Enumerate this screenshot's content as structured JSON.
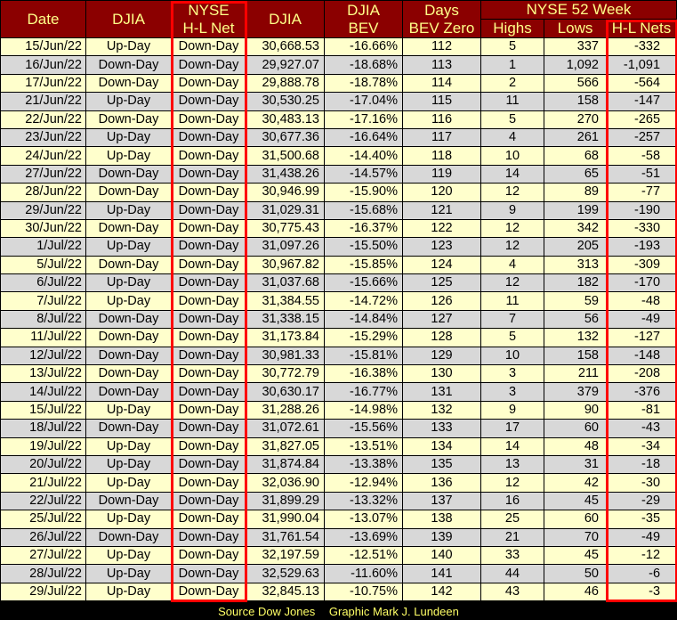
{
  "chart_data": {
    "type": "table",
    "header_groups": {
      "nyse_52_week": "NYSE 52 Week"
    },
    "columns": [
      {
        "key": "date",
        "line1": "Date",
        "line2": ""
      },
      {
        "key": "djia_day",
        "line1": "DJIA",
        "line2": ""
      },
      {
        "key": "nyse_hl_net",
        "line1": "NYSE",
        "line2": "H-L Net"
      },
      {
        "key": "djia",
        "line1": "DJIA",
        "line2": ""
      },
      {
        "key": "djia_bev",
        "line1": "DJIA",
        "line2": "BEV"
      },
      {
        "key": "days_bev_zero",
        "line1": "Days",
        "line2": "BEV Zero"
      },
      {
        "key": "highs",
        "line1": "",
        "line2": "Highs"
      },
      {
        "key": "lows",
        "line1": "",
        "line2": "Lows"
      },
      {
        "key": "hl_nets",
        "line1": "",
        "line2": "H-L Nets"
      }
    ],
    "rows": [
      [
        "15/Jun/22",
        "Up-Day",
        "Down-Day",
        "30,668.53",
        "-16.66%",
        "112",
        "5",
        "337",
        "-332"
      ],
      [
        "16/Jun/22",
        "Down-Day",
        "Down-Day",
        "29,927.07",
        "-18.68%",
        "113",
        "1",
        "1,092",
        "-1,091"
      ],
      [
        "17/Jun/22",
        "Down-Day",
        "Down-Day",
        "29,888.78",
        "-18.78%",
        "114",
        "2",
        "566",
        "-564"
      ],
      [
        "21/Jun/22",
        "Up-Day",
        "Down-Day",
        "30,530.25",
        "-17.04%",
        "115",
        "11",
        "158",
        "-147"
      ],
      [
        "22/Jun/22",
        "Down-Day",
        "Down-Day",
        "30,483.13",
        "-17.16%",
        "116",
        "5",
        "270",
        "-265"
      ],
      [
        "23/Jun/22",
        "Up-Day",
        "Down-Day",
        "30,677.36",
        "-16.64%",
        "117",
        "4",
        "261",
        "-257"
      ],
      [
        "24/Jun/22",
        "Up-Day",
        "Down-Day",
        "31,500.68",
        "-14.40%",
        "118",
        "10",
        "68",
        "-58"
      ],
      [
        "27/Jun/22",
        "Down-Day",
        "Down-Day",
        "31,438.26",
        "-14.57%",
        "119",
        "14",
        "65",
        "-51"
      ],
      [
        "28/Jun/22",
        "Down-Day",
        "Down-Day",
        "30,946.99",
        "-15.90%",
        "120",
        "12",
        "89",
        "-77"
      ],
      [
        "29/Jun/22",
        "Up-Day",
        "Down-Day",
        "31,029.31",
        "-15.68%",
        "121",
        "9",
        "199",
        "-190"
      ],
      [
        "30/Jun/22",
        "Down-Day",
        "Down-Day",
        "30,775.43",
        "-16.37%",
        "122",
        "12",
        "342",
        "-330"
      ],
      [
        "1/Jul/22",
        "Up-Day",
        "Down-Day",
        "31,097.26",
        "-15.50%",
        "123",
        "12",
        "205",
        "-193"
      ],
      [
        "5/Jul/22",
        "Down-Day",
        "Down-Day",
        "30,967.82",
        "-15.85%",
        "124",
        "4",
        "313",
        "-309"
      ],
      [
        "6/Jul/22",
        "Up-Day",
        "Down-Day",
        "31,037.68",
        "-15.66%",
        "125",
        "12",
        "182",
        "-170"
      ],
      [
        "7/Jul/22",
        "Up-Day",
        "Down-Day",
        "31,384.55",
        "-14.72%",
        "126",
        "11",
        "59",
        "-48"
      ],
      [
        "8/Jul/22",
        "Down-Day",
        "Down-Day",
        "31,338.15",
        "-14.84%",
        "127",
        "7",
        "56",
        "-49"
      ],
      [
        "11/Jul/22",
        "Down-Day",
        "Down-Day",
        "31,173.84",
        "-15.29%",
        "128",
        "5",
        "132",
        "-127"
      ],
      [
        "12/Jul/22",
        "Down-Day",
        "Down-Day",
        "30,981.33",
        "-15.81%",
        "129",
        "10",
        "158",
        "-148"
      ],
      [
        "13/Jul/22",
        "Down-Day",
        "Down-Day",
        "30,772.79",
        "-16.38%",
        "130",
        "3",
        "211",
        "-208"
      ],
      [
        "14/Jul/22",
        "Down-Day",
        "Down-Day",
        "30,630.17",
        "-16.77%",
        "131",
        "3",
        "379",
        "-376"
      ],
      [
        "15/Jul/22",
        "Up-Day",
        "Down-Day",
        "31,288.26",
        "-14.98%",
        "132",
        "9",
        "90",
        "-81"
      ],
      [
        "18/Jul/22",
        "Down-Day",
        "Down-Day",
        "31,072.61",
        "-15.56%",
        "133",
        "17",
        "60",
        "-43"
      ],
      [
        "19/Jul/22",
        "Up-Day",
        "Down-Day",
        "31,827.05",
        "-13.51%",
        "134",
        "14",
        "48",
        "-34"
      ],
      [
        "20/Jul/22",
        "Up-Day",
        "Down-Day",
        "31,874.84",
        "-13.38%",
        "135",
        "13",
        "31",
        "-18"
      ],
      [
        "21/Jul/22",
        "Up-Day",
        "Down-Day",
        "32,036.90",
        "-12.94%",
        "136",
        "12",
        "42",
        "-30"
      ],
      [
        "22/Jul/22",
        "Down-Day",
        "Down-Day",
        "31,899.29",
        "-13.32%",
        "137",
        "16",
        "45",
        "-29"
      ],
      [
        "25/Jul/22",
        "Up-Day",
        "Down-Day",
        "31,990.04",
        "-13.07%",
        "138",
        "25",
        "60",
        "-35"
      ],
      [
        "26/Jul/22",
        "Down-Day",
        "Down-Day",
        "31,761.54",
        "-13.69%",
        "139",
        "21",
        "70",
        "-49"
      ],
      [
        "27/Jul/22",
        "Up-Day",
        "Down-Day",
        "32,197.59",
        "-12.51%",
        "140",
        "33",
        "45",
        "-12"
      ],
      [
        "28/Jul/22",
        "Up-Day",
        "Down-Day",
        "32,529.63",
        "-11.60%",
        "141",
        "44",
        "50",
        "-6"
      ],
      [
        "29/Jul/22",
        "Up-Day",
        "Down-Day",
        "32,845.13",
        "-10.75%",
        "142",
        "43",
        "46",
        "-3"
      ]
    ],
    "highlighted_columns": [
      "nyse_hl_net",
      "hl_nets"
    ]
  },
  "footer": {
    "source": "Source Dow Jones",
    "credit": "Graphic Mark J. Lundeen"
  },
  "colors": {
    "header_bg": "#8b0000",
    "header_text": "#ffff88",
    "row_odd": "#ffffcc",
    "row_even": "#d8d8d8",
    "highlight_border": "#ff0000",
    "footer_text": "#ffff66"
  }
}
